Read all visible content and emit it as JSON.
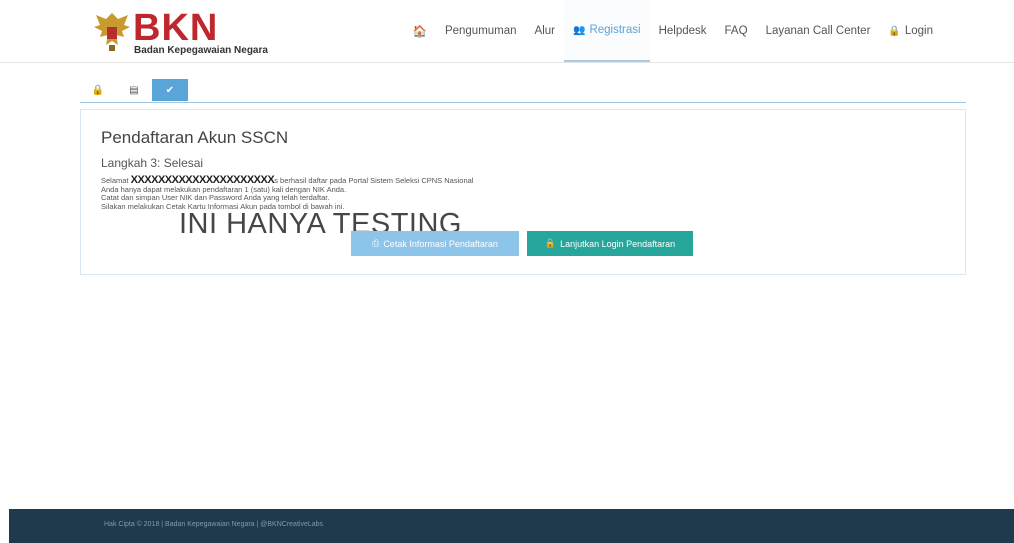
{
  "brand": {
    "logo_text": "BKN",
    "subtitle": "Badan Kepegawaian Negara"
  },
  "nav": {
    "items": [
      {
        "label": "",
        "icon": "home-icon"
      },
      {
        "label": "Pengumuman"
      },
      {
        "label": "Alur"
      },
      {
        "label": "Registrasi",
        "icon": "users-icon",
        "active": true
      },
      {
        "label": "Helpdesk"
      },
      {
        "label": "FAQ"
      },
      {
        "label": "Layanan Call Center"
      },
      {
        "label": "Login",
        "icon": "lock-icon"
      }
    ]
  },
  "tabs": [
    {
      "icon": "lock-icon",
      "glyph": "🔒"
    },
    {
      "icon": "id-card-icon",
      "glyph": "▤"
    },
    {
      "icon": "check-icon",
      "glyph": "✔",
      "active": true
    }
  ],
  "panel": {
    "title": "Pendaftaran Akun SSCN",
    "step": "Langkah 3: Selesai",
    "line1_prefix": "Selamat",
    "line1_masked": "XXXXXXXXXXXXXXXXXXXXX",
    "line1_suffix": "s berhasil daftar pada Portal Sistem Seleksi CPNS Nasional",
    "line2": "Anda hanya dapat melakukan pendaftaran 1 (satu) kali dengan NIK Anda.",
    "line3": "Catat dan simpan User NIK dan Password Anda yang telah terdaftar.",
    "line4": "Silakan melakukan Cetak Kartu Informasi Akun pada tombol di bawah ini.",
    "watermark": "INI HANYA TESTING",
    "print_button": "Cetak Informasi Pendaftaran",
    "login_button": "Lanjutkan Login Pendaftaran"
  },
  "footer": {
    "text": "Hak Cipta © 2018 | Badan Kepegawaian Negara | @BKNCreativeLabs"
  },
  "colors": {
    "brand_red": "#c0272d",
    "accent_blue": "#5aa5d8",
    "print_button": "#8cc4ea",
    "login_button": "#26a69a",
    "footer_bg": "#1f3a4d"
  }
}
